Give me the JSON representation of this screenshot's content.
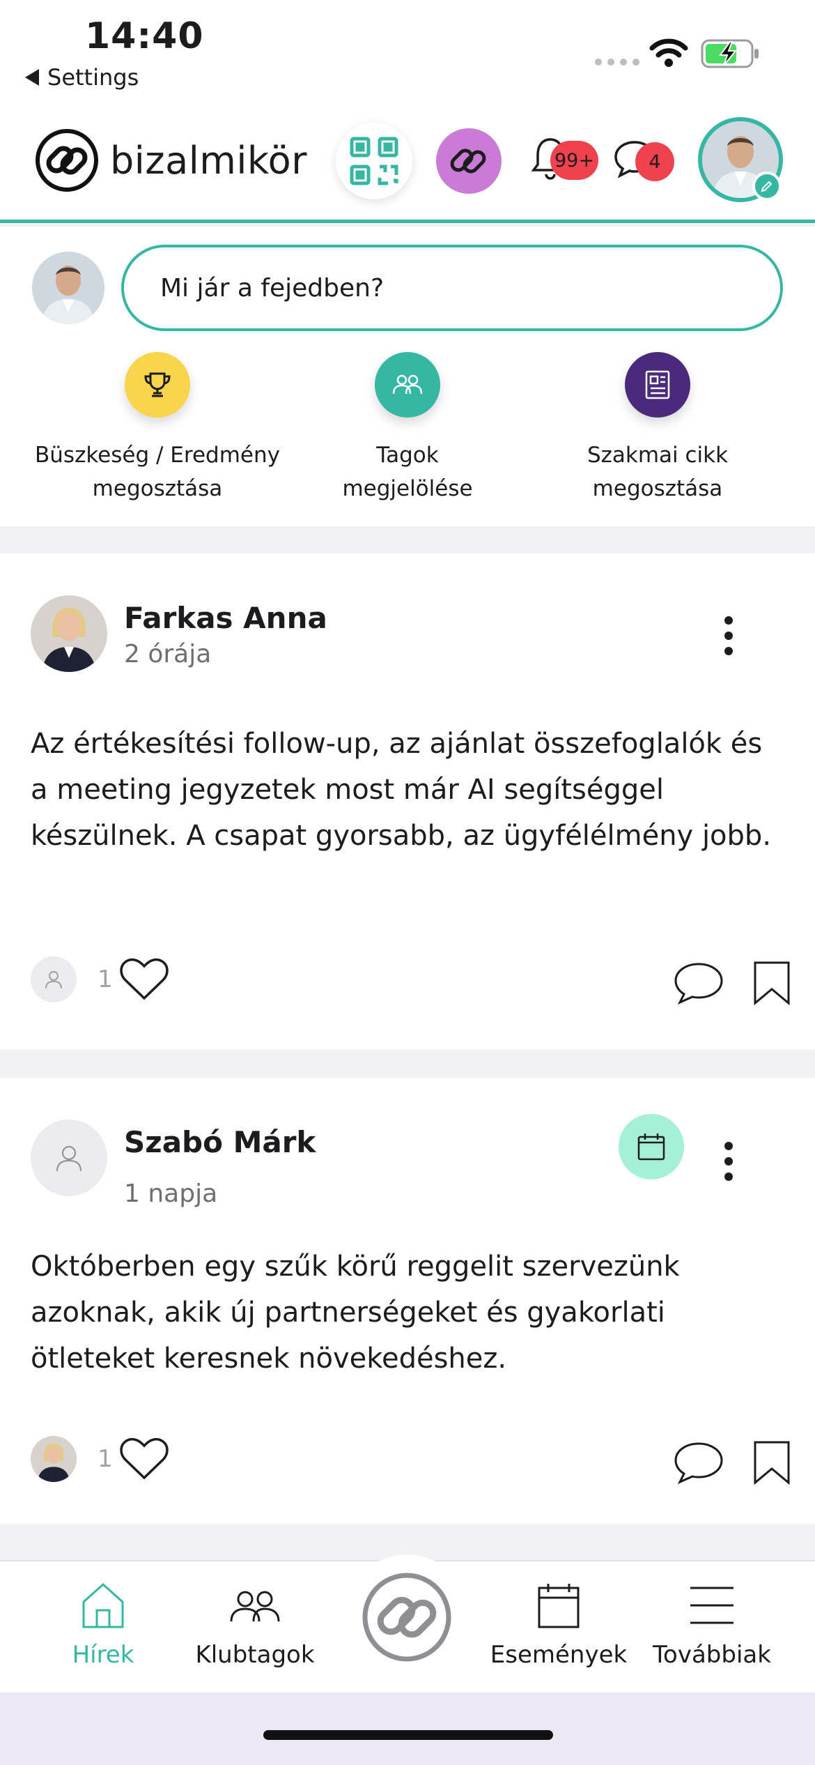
{
  "status_bar": {
    "time": "14:40",
    "back_label": "Settings"
  },
  "header": {
    "logo_text": "bizalmikör",
    "notifications_badge": "99+",
    "messages_badge": "4",
    "colors": {
      "accent": "#35b7a3",
      "chain_button": "#c97bd6",
      "badge": "#f0424e"
    }
  },
  "composer": {
    "placeholder": "Mi jár a fejedben?",
    "actions": [
      {
        "line1": "Büszkeség / Eredmény",
        "line2": "megosztása",
        "icon": "trophy-icon",
        "color": "#f8d54a"
      },
      {
        "line1": "Tagok",
        "line2": "megjelölése",
        "icon": "members-icon",
        "color": "#35b7a3"
      },
      {
        "line1": "Szakmai cikk",
        "line2": "megosztása",
        "icon": "article-icon",
        "color": "#4a2a7a"
      }
    ]
  },
  "posts": [
    {
      "author": "Farkas Anna",
      "time": "2 órája",
      "body": "Az értékesítési follow-up, az ajánlat összefoglalók és a meeting jegyzetek most már AI segítséggel készülnek. A csapat gyorsabb, az ügyfélélmény jobb.",
      "likes": "1"
    },
    {
      "author": "Szabó Márk",
      "time": "1 napja",
      "body": "Októberben egy szűk körű reggelit szervezünk azoknak, akik új partnerségeket és gyakorlati ötleteket keresnek növekedéshez.",
      "likes": "1",
      "event_icon": "calendar-icon"
    }
  ],
  "tab_bar": {
    "tabs": [
      {
        "label": "Hírek",
        "icon": "home-icon",
        "active": true
      },
      {
        "label": "Klubtagok",
        "icon": "members-icon"
      },
      {
        "label": "Események",
        "icon": "calendar-icon"
      },
      {
        "label": "Továbbiak",
        "icon": "menu-icon"
      }
    ]
  }
}
